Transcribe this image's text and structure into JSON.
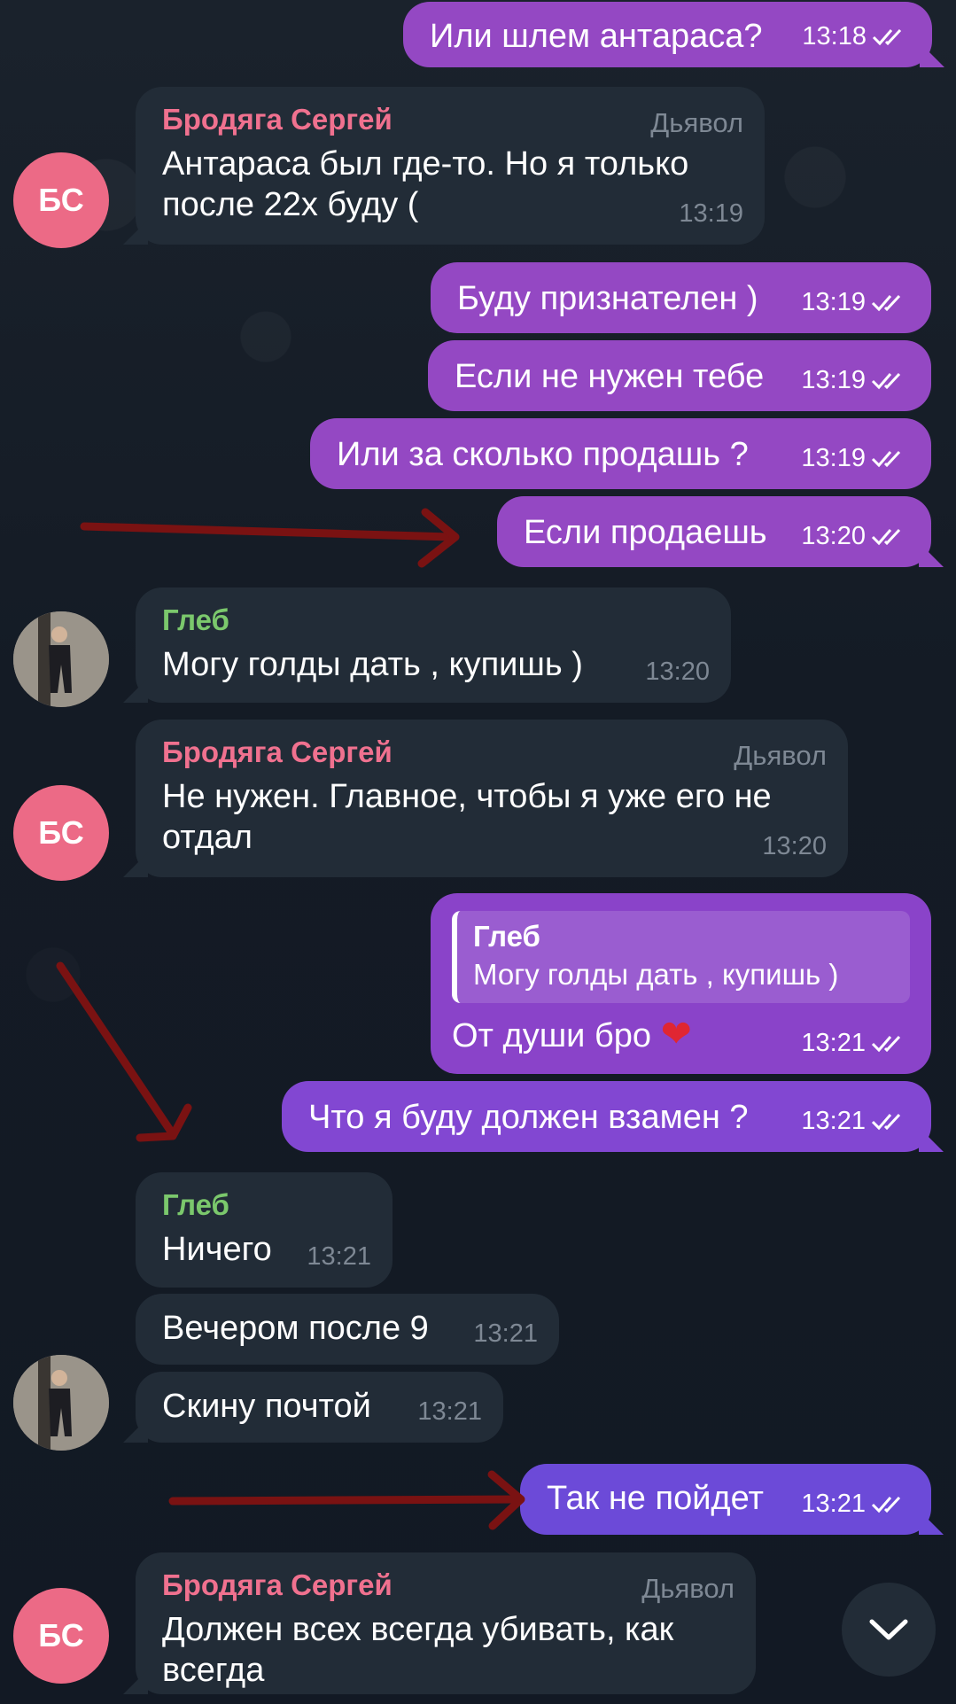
{
  "messages": {
    "m1": {
      "text": "Или шлем антараса?",
      "time": "13:18"
    },
    "m2": {
      "sender": "Бродяга Сергей",
      "role": "Дьявол",
      "text_line1": "Антараса был где-то. Но я только",
      "text_line2": "после 22х буду (",
      "time": "13:19"
    },
    "m3": {
      "text": "Буду признателен )",
      "time": "13:19"
    },
    "m4": {
      "text": "Если не нужен тебе",
      "time": "13:19"
    },
    "m5": {
      "text": "Или за сколько продашь ?",
      "time": "13:19"
    },
    "m6": {
      "text": "Если продаешь",
      "time": "13:20"
    },
    "m7": {
      "sender": "Глеб",
      "text": "Могу голды дать , купишь )",
      "time": "13:20"
    },
    "m8": {
      "sender": "Бродяга Сергей",
      "role": "Дьявол",
      "text_line1": "Не нужен. Главное, чтобы я уже его не",
      "text_line2": "отдал",
      "time": "13:20"
    },
    "m9": {
      "quote_name": "Глеб",
      "quote_text": "Могу голды дать , купишь )",
      "text": "От души бро",
      "emoji": "❤",
      "time": "13:21"
    },
    "m10": {
      "text": "Что я буду должен взамен ?",
      "time": "13:21"
    },
    "m11": {
      "sender": "Глеб",
      "text": "Ничего",
      "time": "13:21"
    },
    "m12": {
      "text": "Вечером после 9",
      "time": "13:21"
    },
    "m13": {
      "text": "Скину почтой",
      "time": "13:21"
    },
    "m14": {
      "text": "Так не пойдет",
      "time": "13:21"
    },
    "m15": {
      "sender": "Бродяга Сергей",
      "role": "Дьявол",
      "text_line1": "Должен всех всегда убивать, как",
      "text_line2": "всегда"
    }
  },
  "avatars": {
    "serg_initials": "БС"
  },
  "icons": {
    "read": "double-check-icon",
    "scroll": "chevron-down-icon"
  },
  "colors": {
    "outgoing": "#9448c3",
    "outgoing_latest": "#6c4ad8",
    "incoming": "#222c37",
    "sender_pink": "#f0718f",
    "sender_green": "#7bc86c",
    "arrow": "#7a1212"
  }
}
